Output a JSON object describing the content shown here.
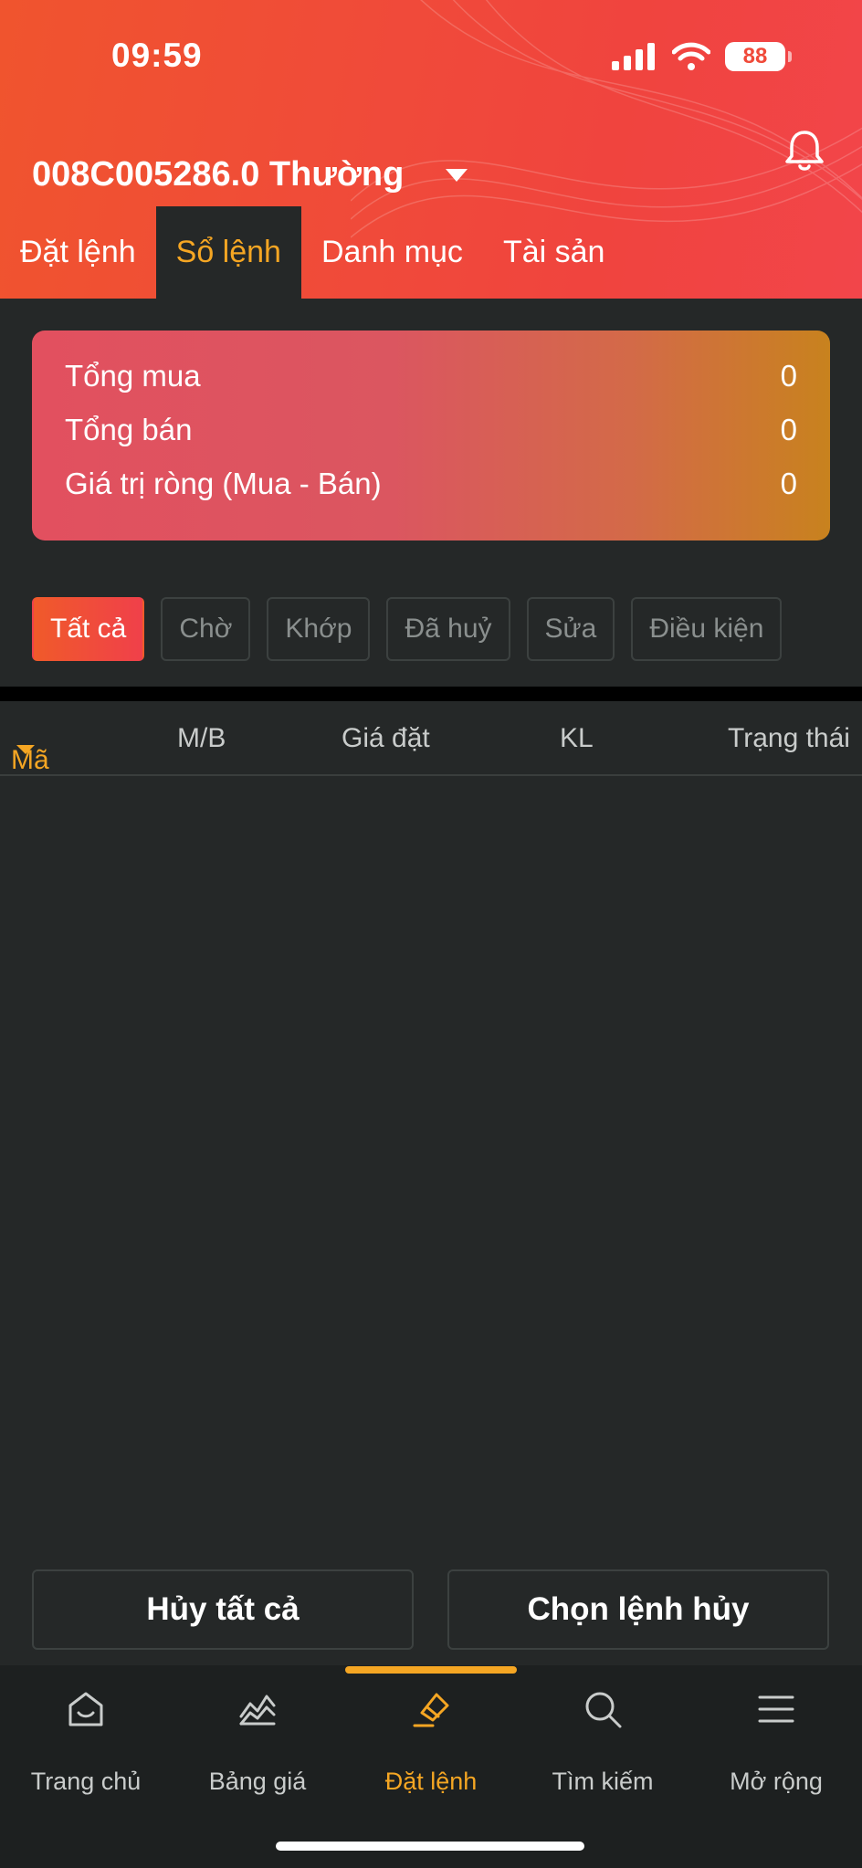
{
  "status": {
    "time": "09:59",
    "battery": "88"
  },
  "header": {
    "account": "008C005286.0 Thường",
    "tabs": [
      {
        "label": "Đặt lệnh",
        "active": false
      },
      {
        "label": "Sổ lệnh",
        "active": true
      },
      {
        "label": "Danh mục",
        "active": false
      },
      {
        "label": "Tài sản",
        "active": false
      }
    ]
  },
  "summary": {
    "rows": [
      {
        "label": "Tổng mua",
        "value": "0"
      },
      {
        "label": "Tổng bán",
        "value": "0"
      },
      {
        "label": "Giá trị ròng (Mua - Bán)",
        "value": "0"
      }
    ]
  },
  "filters": [
    {
      "label": "Tất cả",
      "active": true
    },
    {
      "label": "Chờ",
      "active": false
    },
    {
      "label": "Khớp",
      "active": false
    },
    {
      "label": "Đã huỷ",
      "active": false
    },
    {
      "label": "Sửa",
      "active": false
    },
    {
      "label": "Điều kiện",
      "active": false
    }
  ],
  "table": {
    "columns": [
      "Mã",
      "M/B",
      "Giá đặt",
      "KL",
      "Trạng thái"
    ]
  },
  "actions": {
    "cancel_all": "Hủy tất cả",
    "select_cancel": "Chọn lệnh hủy"
  },
  "nav": {
    "items": [
      {
        "label": "Trang chủ",
        "icon": "home-icon"
      },
      {
        "label": "Bảng giá",
        "icon": "chart-icon"
      },
      {
        "label": "Đặt lệnh",
        "icon": "order-icon",
        "active": true
      },
      {
        "label": "Tìm kiếm",
        "icon": "search-icon"
      },
      {
        "label": "Mở rộng",
        "icon": "menu-icon"
      }
    ]
  },
  "colors": {
    "accent": "#f5a623",
    "header": "#f04a3a",
    "background": "#252828"
  }
}
